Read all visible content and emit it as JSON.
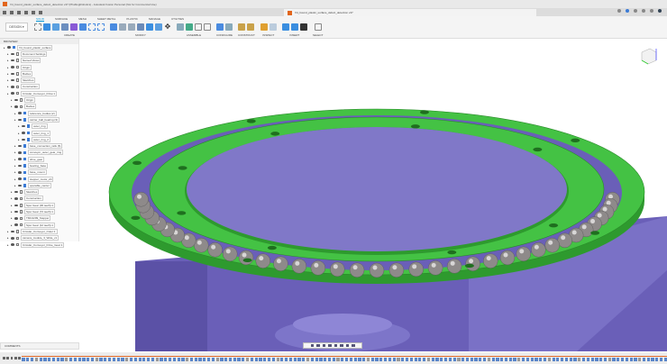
{
  "window": {
    "title": "V4_bound_plastic_surface_defect_detection v47 (PhablogRobotics) - Autodesk Fusion Personal (Not for Commercial Use)"
  },
  "document_tab": {
    "label": "V4_bound_plastic_surface_defect_detection v47"
  },
  "toolbar": {
    "workspace": "DESIGN",
    "tabs": [
      "SOLID",
      "SURFACE",
      "MESH",
      "SHEET METAL",
      "PLASTIC",
      "MANAGE",
      "UTILITIES"
    ],
    "groups": [
      "CREATE",
      "MODIFY",
      "ASSEMBLE",
      "CONSTRUCT",
      "INSPECT",
      "INSERT",
      "SELECT"
    ],
    "configure": "CONFIGURE"
  },
  "browser": {
    "title": "BROWSER",
    "nodes": [
      {
        "label": "V4_bound_plastic_surface",
        "depth": 0
      },
      {
        "label": "Document Settings",
        "depth": 1
      },
      {
        "label": "Named Views",
        "depth": 1
      },
      {
        "label": "Origin",
        "depth": 1
      },
      {
        "label": "Bodies",
        "depth": 1
      },
      {
        "label": "Sketches",
        "depth": 1
      },
      {
        "label": "Construction",
        "depth": 1
      },
      {
        "label": "Circular_Conveyor_Drive:1",
        "depth": 1
      },
      {
        "label": "Origin",
        "depth": 2
      },
      {
        "label": "Bodies",
        "depth": 2
      },
      {
        "label": "reference_bodies (2)",
        "depth": 3
      },
      {
        "label": "carrier_ball_bearing (3)",
        "depth": 3
      },
      {
        "label": "outer_ring",
        "depth": 4
      },
      {
        "label": "outer_ring_1",
        "depth": 4
      },
      {
        "label": "outer_ring_2",
        "depth": 4
      },
      {
        "label": "base_connection_rails (6)",
        "depth": 3
      },
      {
        "label": "conveyor_outer_gear_ring",
        "depth": 3
      },
      {
        "label": "drive_gear",
        "depth": 3
      },
      {
        "label": "bearing_base",
        "depth": 3
      },
      {
        "label": "base_mount",
        "depth": 3
      },
      {
        "label": "stepper_motor_20",
        "depth": 3
      },
      {
        "label": "operable_center",
        "depth": 3
      },
      {
        "label": "Sketches",
        "depth": 2
      },
      {
        "label": "Construction",
        "depth": 2
      },
      {
        "label": "Spur Gear (36 teeth):1",
        "depth": 2
      },
      {
        "label": "Spur Gear (72 teeth):1",
        "depth": 2
      },
      {
        "label": "TMC2209_Stepper",
        "depth": 2
      },
      {
        "label": "Spur Gear (12 teeth):1",
        "depth": 2
      },
      {
        "label": "Circular_Conveyor_Outer:1",
        "depth": 1
      },
      {
        "label": "camera_module_3_Wide_v1",
        "depth": 1
      },
      {
        "label": "Circular_Conveyor_Drive_Gear:1",
        "depth": 1
      }
    ]
  },
  "comments": {
    "label": "COMMENTS"
  },
  "colors": {
    "green": "#3fbf3f",
    "purple": "#7b72c4",
    "accent": "#0696d7"
  }
}
